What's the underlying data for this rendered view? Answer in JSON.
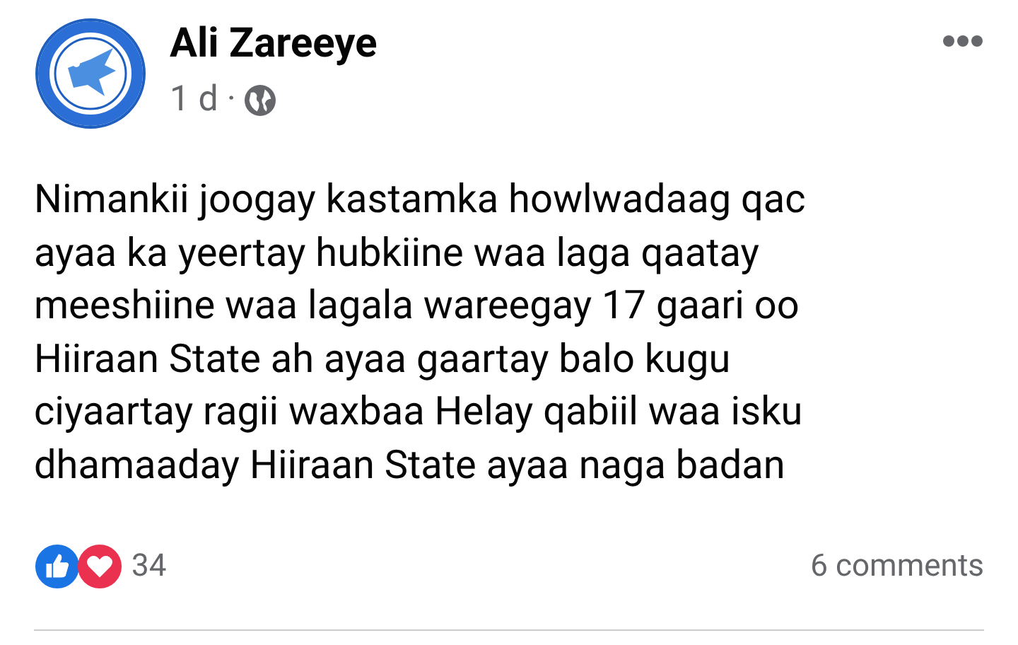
{
  "post": {
    "author": "Ali Zareeye",
    "time": "1 d",
    "separator": "·",
    "body_lines": [
      "Nimankii joogay kastamka howlwadaag qac",
      "ayaa ka yeertay hubkiine waa laga qaatay",
      "meeshiine waa lagala wareegay 17 gaari oo",
      "Hiiraan State ah ayaa gaartay balo kugu",
      "ciyaartay ragii waxbaa Helay qabiil waa isku",
      "dhamaaday Hiiraan State ayaa naga badan"
    ],
    "reaction_count": "34",
    "comments": "6 comments"
  }
}
